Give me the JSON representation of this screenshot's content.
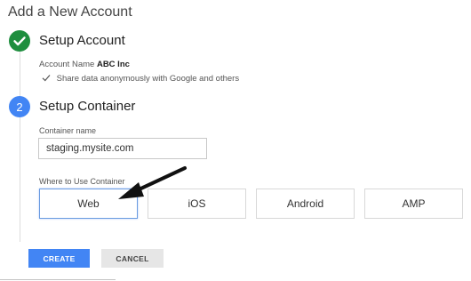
{
  "page": {
    "title": "Add a New Account"
  },
  "step1": {
    "title": "Setup Account",
    "account_label": "Account Name",
    "account_value": "ABC Inc",
    "share_text": "Share data anonymously with Google and others",
    "status_color": "#1e8e3e"
  },
  "step2": {
    "number": "2",
    "title": "Setup Container",
    "container_label": "Container name",
    "container_value": "staging.mysite.com",
    "where_label": "Where to Use Container",
    "options": [
      "Web",
      "iOS",
      "Android",
      "AMP"
    ],
    "selected_option": "Web",
    "accent_color": "#4285f4"
  },
  "actions": {
    "create_label": "CREATE",
    "cancel_label": "CANCEL"
  }
}
